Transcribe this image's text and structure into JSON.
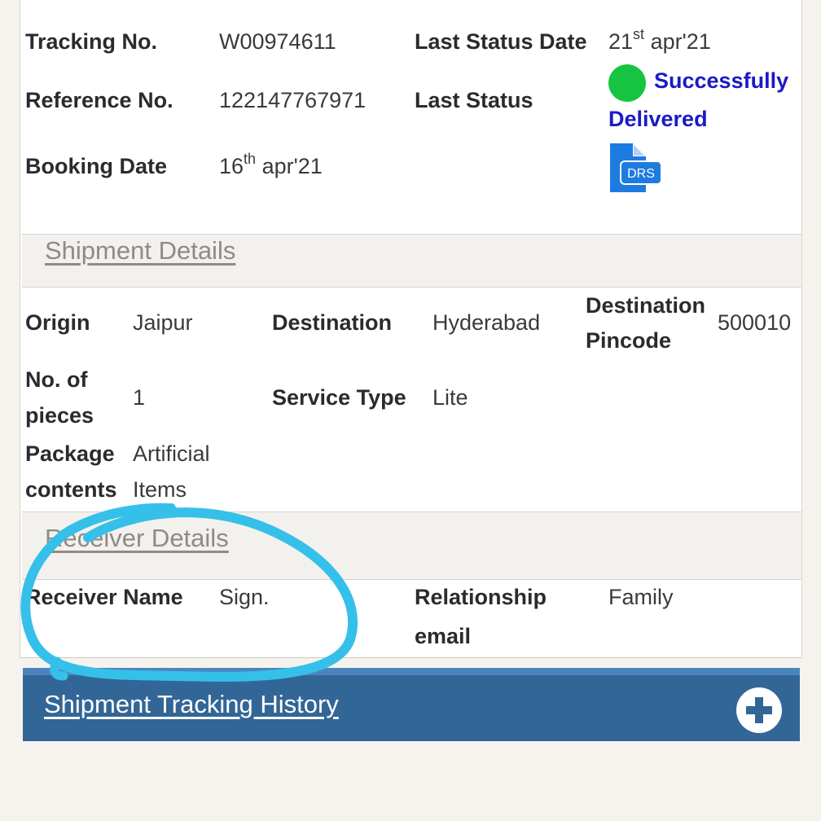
{
  "tracking": {
    "tracking_no_label": "Tracking No.",
    "tracking_no_value": "W00974611",
    "reference_no_label": "Reference No.",
    "reference_no_value": "122147767971",
    "booking_date_label": "Booking Date",
    "booking_date_day": "16",
    "booking_date_suffix": "th",
    "booking_date_rest": " apr'21",
    "last_status_date_label": "Last Status Date",
    "last_status_date_day": "21",
    "last_status_date_suffix": "st",
    "last_status_date_rest": " apr'21",
    "last_status_label": "Last Status",
    "last_status_line1": "Successfully",
    "last_status_line2": "Delivered",
    "status_dot_color": "#17c441",
    "drs_icon_label": "DRS",
    "drs_icon_name": "document-drs-icon"
  },
  "shipment_details": {
    "title": "Shipment Details",
    "origin_label": "Origin",
    "origin_value": "Jaipur",
    "destination_label": "Destination",
    "destination_value": "Hyderabad",
    "destination_pincode_label_1": "Destination",
    "destination_pincode_label_2": "Pincode",
    "destination_pincode_value": "500010",
    "pieces_label_1": "No. of",
    "pieces_label_2": "pieces",
    "pieces_value": "1",
    "service_type_label": "Service Type",
    "service_type_value": "Lite",
    "package_label_1": "Package",
    "package_label_2": "contents",
    "package_value_1": "Artificial",
    "package_value_2": "Items"
  },
  "receiver_details": {
    "title": "Receiver Details",
    "receiver_name_label": "Receiver Name",
    "receiver_name_value": "Sign.",
    "relationship_label": "Relationship",
    "relationship_value": "Family",
    "email_label": "email"
  },
  "history": {
    "title": "Shipment Tracking History",
    "expand_icon_name": "plus-circle-icon"
  },
  "colors": {
    "history_bar": "#326696",
    "status_link": "#1a1ac8",
    "annotation_stroke": "#35c0ea"
  }
}
